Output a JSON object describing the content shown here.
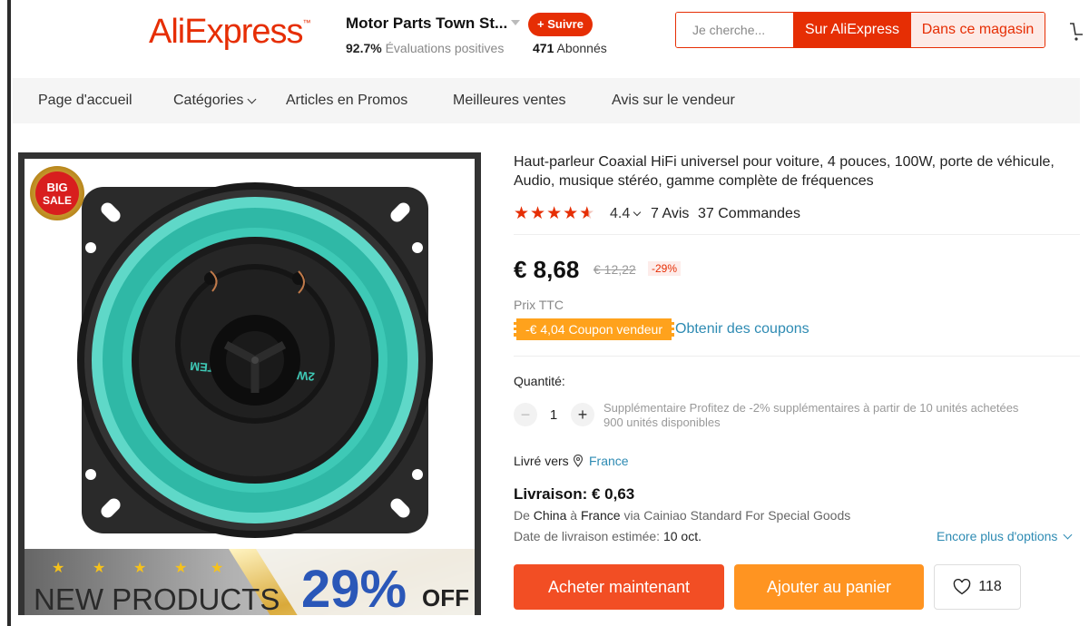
{
  "header": {
    "logo_text": "AliExpress",
    "logo_tm": "™",
    "store_name": "Motor Parts Town St...",
    "follow_label": "+ Suivre",
    "positive_pct": "92.7%",
    "positive_label": "Évaluations positives",
    "followers_count": "471",
    "followers_label": "Abonnés",
    "search": {
      "placeholder": "Je cherche...",
      "ae_button": "Sur AliExpress",
      "store_button": "Dans ce magasin"
    },
    "colors": {
      "brand": "#e62e04"
    }
  },
  "nav": {
    "items": [
      "Page d'accueil",
      "Catégories",
      "Articles en Promos",
      "Meilleures ventes",
      "Avis sur le vendeur"
    ]
  },
  "product_image": {
    "badge_big": "BIG",
    "badge_sale": "SALE",
    "speaker_text": "2WAY NdFeB SYSTEM",
    "banner_new": "NEW PRODUCTS",
    "banner_pct": "29%",
    "banner_off": "OFF"
  },
  "product": {
    "title": "Haut-parleur Coaxial HiFi universel pour voiture, 4 pouces, 100W, porte de véhicule, Audio, musique stéréo, gamme complète de fréquences",
    "rating": "4.4",
    "rating_stars": 4.4,
    "reviews": "7 Avis",
    "orders": "37 Commandes",
    "price": "€ 8,68",
    "old_price": "€ 12,22",
    "discount": "-29%",
    "ttc": "Prix TTC",
    "coupon": "-€ 4,04 Coupon vendeur",
    "get_coupons": "Obtenir des coupons",
    "qty_label": "Quantité:",
    "qty_value": "1",
    "qty_minus": "−",
    "qty_plus": "+",
    "qty_note_1": "Supplémentaire Profitez de -2% supplémentaires à partir de 10 unités achetées",
    "qty_note_2": "900 unités disponibles",
    "deliver_to_label": "Livré vers",
    "deliver_country": "France",
    "shipping": "Livraison: € 0,63",
    "route_de": "De",
    "route_from": "China",
    "route_a": "à",
    "route_to": "France",
    "route_via": "via Cainiao Standard For Special Goods",
    "est_label": "Date de livraison estimée:",
    "est_date": "10 oct.",
    "more_options": "Encore plus d'options",
    "buy_now": "Acheter maintenant",
    "add_to_cart": "Ajouter au panier",
    "wishlist_count": "118"
  }
}
